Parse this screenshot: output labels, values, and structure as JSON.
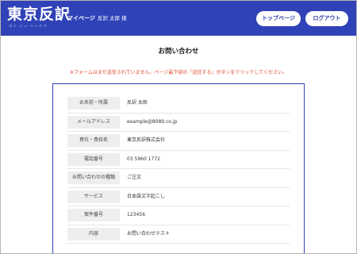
{
  "header": {
    "logo": "東京反訳",
    "logo_sub": "ゴミ·ジュ·ハンヤク",
    "mypage": "マイページ",
    "user": "反訳 太郎 様",
    "top_button": "トップページ",
    "logout_button": "ログアウト",
    "bg_color": "#3042b8"
  },
  "page": {
    "title": "お問い合わせ",
    "notice": "※フォームはまだ送信されていません。ページ最下部の「送信する」ボタンをクリックしてください。",
    "notice_color": "#e04a2f"
  },
  "form": {
    "rows": [
      {
        "label": "お名前・所属",
        "value": "反訳 太郎"
      },
      {
        "label": "メールアドレス",
        "value": "example@8089.co.jp"
      },
      {
        "label": "貴社・貴校名",
        "value": "東京反訳株式会社"
      },
      {
        "label": "電話番号",
        "value": "03 5960 1772"
      },
      {
        "label": "お問い合わせの種類",
        "value": "ご注文"
      },
      {
        "label": "サービス",
        "value": "日本語文字起こし"
      },
      {
        "label": "案件番号",
        "value": "123456"
      },
      {
        "label": "内容",
        "value": "お問い合わせテスト"
      }
    ]
  }
}
